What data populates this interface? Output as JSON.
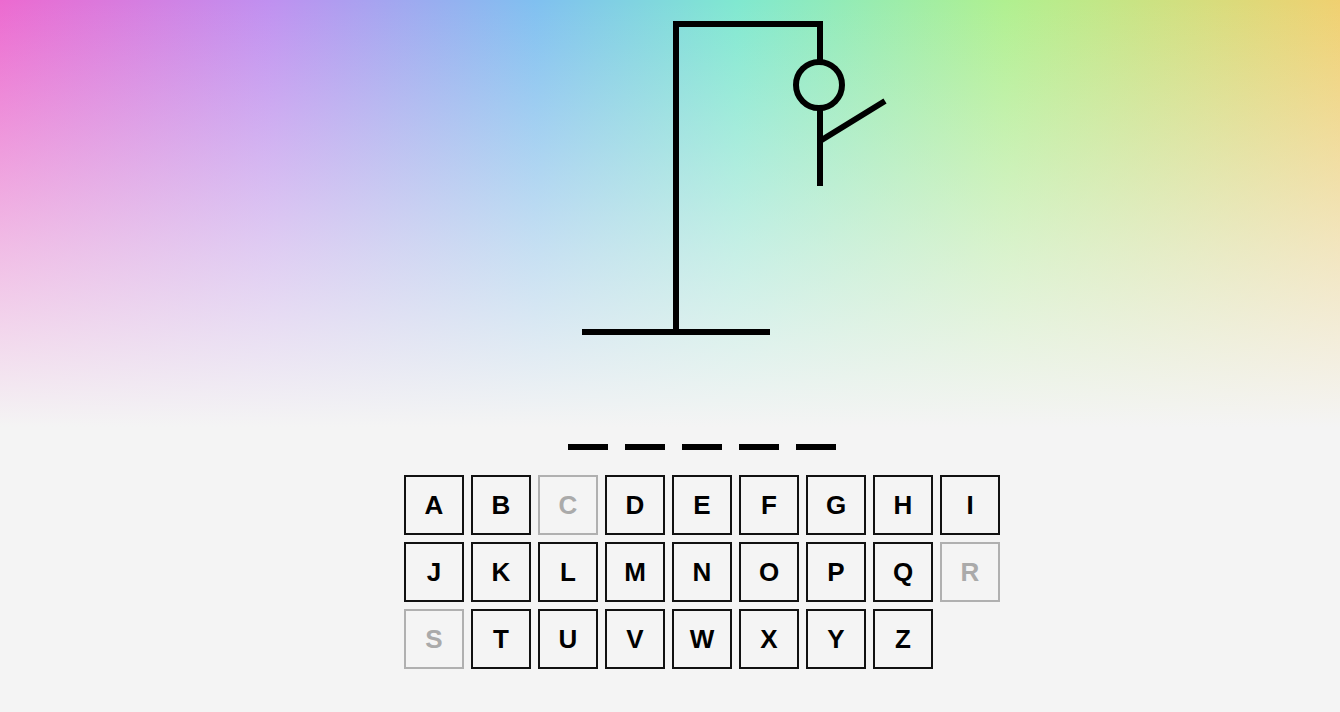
{
  "hangman": {
    "stage": 3
  },
  "word": [
    {
      "letter": "",
      "revealed": false
    },
    {
      "letter": "",
      "revealed": false
    },
    {
      "letter": "",
      "revealed": false
    },
    {
      "letter": "",
      "revealed": false
    },
    {
      "letter": "",
      "revealed": false
    }
  ],
  "keys": [
    {
      "label": "A",
      "disabled": false
    },
    {
      "label": "B",
      "disabled": false
    },
    {
      "label": "C",
      "disabled": true
    },
    {
      "label": "D",
      "disabled": false
    },
    {
      "label": "E",
      "disabled": false
    },
    {
      "label": "F",
      "disabled": false
    },
    {
      "label": "G",
      "disabled": false
    },
    {
      "label": "H",
      "disabled": false
    },
    {
      "label": "I",
      "disabled": false
    },
    {
      "label": "J",
      "disabled": false
    },
    {
      "label": "K",
      "disabled": false
    },
    {
      "label": "L",
      "disabled": false
    },
    {
      "label": "M",
      "disabled": false
    },
    {
      "label": "N",
      "disabled": false
    },
    {
      "label": "O",
      "disabled": false
    },
    {
      "label": "P",
      "disabled": false
    },
    {
      "label": "Q",
      "disabled": false
    },
    {
      "label": "R",
      "disabled": true
    },
    {
      "label": "S",
      "disabled": true
    },
    {
      "label": "T",
      "disabled": false
    },
    {
      "label": "U",
      "disabled": false
    },
    {
      "label": "V",
      "disabled": false
    },
    {
      "label": "W",
      "disabled": false
    },
    {
      "label": "X",
      "disabled": false
    },
    {
      "label": "Y",
      "disabled": false
    },
    {
      "label": "Z",
      "disabled": false
    }
  ]
}
